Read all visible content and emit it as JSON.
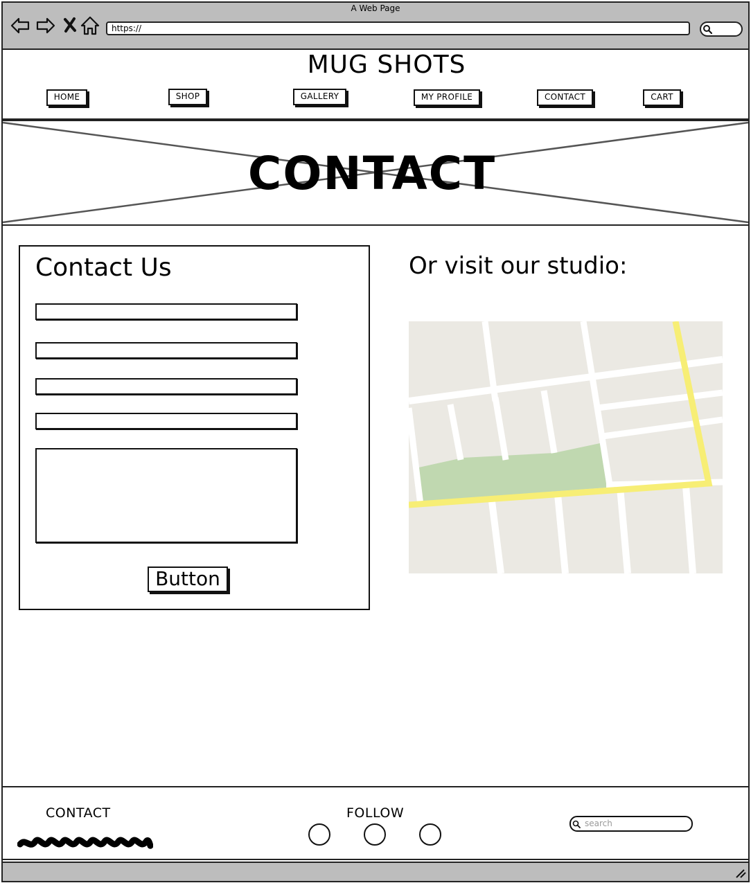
{
  "window": {
    "title": "A Web Page",
    "url": "https://"
  },
  "header": {
    "logo": "MUG SHOTS",
    "nav": [
      {
        "label": "HOME"
      },
      {
        "label": "SHOP"
      },
      {
        "label": "GALLERY"
      },
      {
        "label": "MY PROFILE"
      },
      {
        "label": "CONTACT"
      },
      {
        "label": "CART"
      }
    ]
  },
  "hero": {
    "title": "CONTACT"
  },
  "contact_form": {
    "title": "Contact Us",
    "fields": [
      "",
      "",
      "",
      ""
    ],
    "message": "",
    "submit_label": "Button"
  },
  "map_section": {
    "title": "Or visit our studio:"
  },
  "footer": {
    "contact_label": "CONTACT",
    "follow_label": "FOLLOW",
    "search_placeholder": "search"
  },
  "icons": {
    "back": "back-arrow-icon",
    "forward": "forward-arrow-icon",
    "stop": "close-icon",
    "home": "home-icon",
    "search": "search-icon",
    "resize": "resize-grip-icon"
  },
  "colors": {
    "chrome": "#bdbdbd",
    "map_land": "#ebe9e3",
    "map_park": "#c0d8b0",
    "map_highway": "#f7ee75",
    "map_road": "#ffffff"
  }
}
